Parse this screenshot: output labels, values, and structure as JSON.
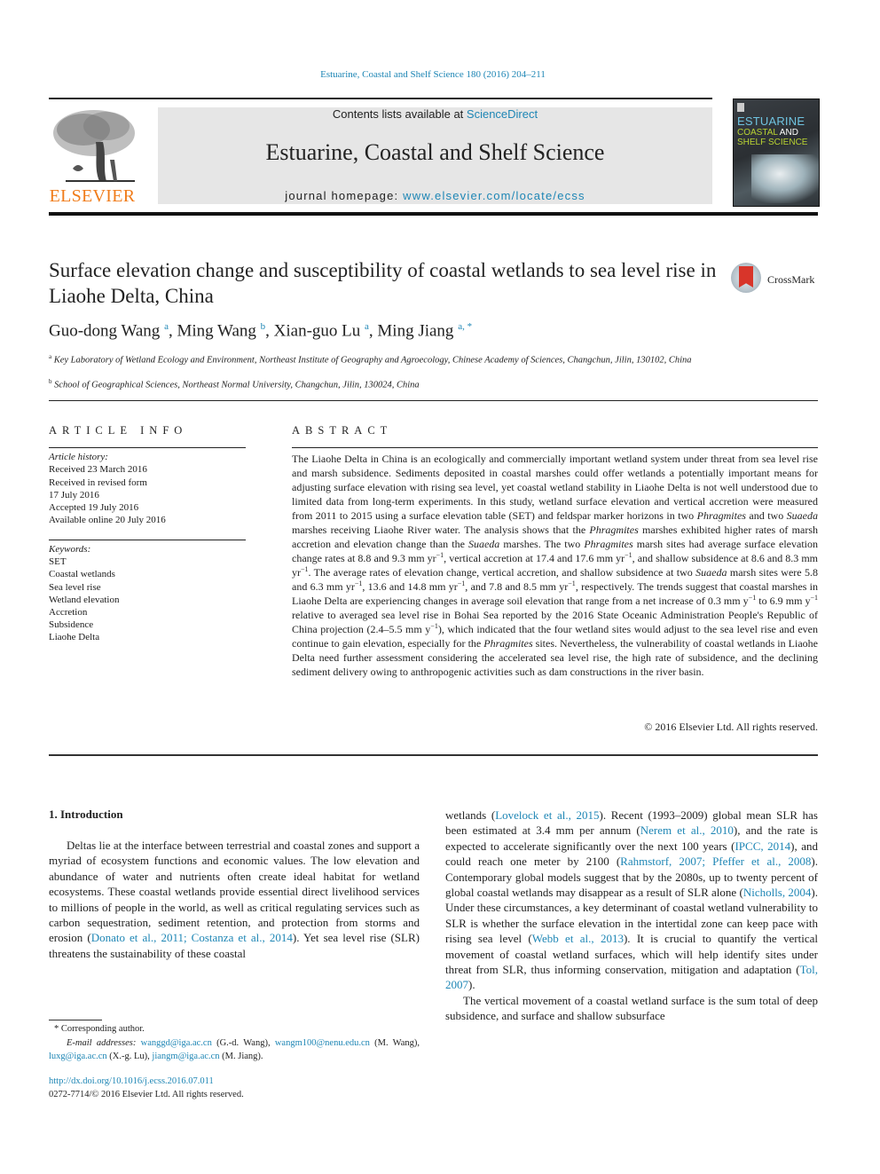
{
  "header": {
    "citation": "Estuarine, Coastal and Shelf Science 180 (2016) 204–211",
    "publisher_logo_text": "ELSEVIER",
    "contents_prefix": "Contents lists available at ",
    "contents_link": "ScienceDirect",
    "journal_title": "Estuarine, Coastal and Shelf Science",
    "homepage_prefix": "journal homepage: ",
    "homepage_link": "www.elsevier.com/locate/ecss",
    "cover": {
      "line1": "ESTUARINE",
      "line2a": "COASTAL",
      "line2b": " AND",
      "line3": "SHELF SCIENCE"
    }
  },
  "article": {
    "title": "Surface elevation change and susceptibility of coastal wetlands to sea level rise in Liaohe Delta, China",
    "crossmark_label": "CrossMark",
    "authors": [
      {
        "name": "Guo-dong Wang",
        "sup": "a"
      },
      {
        "name": "Ming Wang",
        "sup": "b"
      },
      {
        "name": "Xian-guo Lu",
        "sup": "a"
      },
      {
        "name": "Ming Jiang",
        "sup": "a, *"
      }
    ],
    "affiliations": [
      {
        "key": "a",
        "text": "Key Laboratory of Wetland Ecology and Environment, Northeast Institute of Geography and Agroecology, Chinese Academy of Sciences, Changchun, Jilin, 130102, China"
      },
      {
        "key": "b",
        "text": "School of Geographical Sciences, Northeast Normal University, Changchun, Jilin, 130024, China"
      }
    ]
  },
  "article_info": {
    "heading": "ARTICLE INFO",
    "history_caption": "Article history:",
    "history": [
      "Received 23 March 2016",
      "Received in revised form",
      "17 July 2016",
      "Accepted 19 July 2016",
      "Available online 20 July 2016"
    ],
    "keywords_caption": "Keywords:",
    "keywords": [
      "SET",
      "Coastal wetlands",
      "Sea level rise",
      "Wetland elevation",
      "Accretion",
      "Subsidence",
      "Liaohe Delta"
    ]
  },
  "abstract": {
    "heading": "ABSTRACT",
    "segments": [
      {
        "t": "The Liaohe Delta in China is an ecologically and commercially important wetland system under threat from sea level rise and marsh subsidence. Sediments deposited in coastal marshes could offer wetlands a potentially important means for adjusting surface elevation with rising sea level, yet coastal wetland stability in Liaohe Delta is not well understood due to limited data from long-term experiments. In this study, wetland surface elevation and vertical accretion were measured from 2011 to 2015 using a surface elevation table (SET) and feldspar marker horizons in two "
      },
      {
        "t": "Phragmites",
        "s": "i"
      },
      {
        "t": " and two "
      },
      {
        "t": "Suaeda",
        "s": "i"
      },
      {
        "t": " marshes receiving Liaohe River water. The analysis shows that the "
      },
      {
        "t": "Phragmites",
        "s": "i"
      },
      {
        "t": " marshes exhibited higher rates of marsh accretion and elevation change than the "
      },
      {
        "t": "Suaeda",
        "s": "i"
      },
      {
        "t": " marshes. The two "
      },
      {
        "t": "Phragmites",
        "s": "i"
      },
      {
        "t": " marsh sites had average surface elevation change rates at 8.8 and 9.3 mm yr"
      },
      {
        "t": "−1",
        "s": "sup"
      },
      {
        "t": ", vertical accretion at 17.4 and 17.6 mm yr"
      },
      {
        "t": "−1",
        "s": "sup"
      },
      {
        "t": ", and shallow subsidence at 8.6 and 8.3 mm yr"
      },
      {
        "t": "−1",
        "s": "sup"
      },
      {
        "t": ". The average rates of elevation change, vertical accretion, and shallow subsidence at two "
      },
      {
        "t": "Suaeda",
        "s": "i"
      },
      {
        "t": " marsh sites were 5.8 and 6.3 mm yr"
      },
      {
        "t": "−1",
        "s": "sup"
      },
      {
        "t": ", 13.6 and 14.8 mm yr"
      },
      {
        "t": "−1",
        "s": "sup"
      },
      {
        "t": ", and 7.8 and 8.5 mm yr"
      },
      {
        "t": "−1",
        "s": "sup"
      },
      {
        "t": ", respectively. The trends suggest that coastal marshes in Liaohe Delta are experiencing changes in average soil elevation that range from a net increase of 0.3 mm y"
      },
      {
        "t": "−1",
        "s": "sup"
      },
      {
        "t": " to 6.9 mm y"
      },
      {
        "t": "−1",
        "s": "sup"
      },
      {
        "t": " relative to averaged sea level rise in Bohai Sea reported by the 2016 State Oceanic Administration People's Republic of China projection (2.4–5.5 mm y"
      },
      {
        "t": "−1",
        "s": "sup"
      },
      {
        "t": "), which indicated that the four wetland sites would adjust to the sea level rise and even continue to gain elevation, especially for the "
      },
      {
        "t": "Phragmites",
        "s": "i"
      },
      {
        "t": " sites. Nevertheless, the vulnerability of coastal wetlands in Liaohe Delta need further assessment considering the accelerated sea level rise, the high rate of subsidence, and the declining sediment delivery owing to anthropogenic activities such as dam constructions in the river basin."
      }
    ],
    "copyright": "© 2016 Elsevier Ltd. All rights reserved."
  },
  "introduction": {
    "heading": "1.  Introduction",
    "col1": [
      {
        "t": "Deltas lie at the interface between terrestrial and coastal zones and support a myriad of ecosystem functions and economic values. The low elevation and abundance of water and nutrients often create ideal habitat for wetland ecosystems. These coastal wetlands provide essential direct livelihood services to millions of people in the world, as well as critical regulating services such as carbon sequestration, sediment retention, and protection from storms and erosion ("
      },
      {
        "t": "Donato et al., 2011; Costanza et al., 2014",
        "s": "link"
      },
      {
        "t": "). Yet sea level rise (SLR) threatens the sustainability of these coastal"
      }
    ],
    "col2_p1": [
      {
        "t": "wetlands ("
      },
      {
        "t": "Lovelock et al., 2015",
        "s": "link"
      },
      {
        "t": "). Recent (1993–2009) global mean SLR has been estimated at 3.4 mm per annum ("
      },
      {
        "t": "Nerem et al., 2010",
        "s": "link"
      },
      {
        "t": "), and the rate is expected to accelerate significantly over the next 100 years ("
      },
      {
        "t": "IPCC, 2014",
        "s": "link"
      },
      {
        "t": "), and could reach one meter by 2100 ("
      },
      {
        "t": "Rahmstorf, 2007; Pfeffer et al., 2008",
        "s": "link"
      },
      {
        "t": "). Contemporary global models suggest that by the 2080s, up to twenty percent of global coastal wetlands may disappear as a result of SLR alone ("
      },
      {
        "t": "Nicholls, 2004",
        "s": "link"
      },
      {
        "t": "). Under these circumstances, a key determinant of coastal wetland vulnerability to SLR is whether the surface elevation in the intertidal zone can keep pace with rising sea level ("
      },
      {
        "t": "Webb et al., 2013",
        "s": "link"
      },
      {
        "t": "). It is crucial to quantify the vertical movement of coastal wetland surfaces, which will help identify sites under threat from SLR, thus informing conservation, mitigation and adaptation ("
      },
      {
        "t": "Tol, 2007",
        "s": "link"
      },
      {
        "t": ")."
      }
    ],
    "col2_p2": [
      {
        "t": "The vertical movement of a coastal wetland surface is the sum total of deep subsidence, and surface and shallow subsurface"
      }
    ]
  },
  "footnotes": {
    "corresponding": "* Corresponding author.",
    "email_caption": "E-mail addresses:",
    "emails": [
      {
        "addr": "wanggd@iga.ac.cn",
        "who": "(G.-d. Wang)"
      },
      {
        "addr": "wangm100@nenu.edu.cn",
        "who": "(M. Wang)"
      },
      {
        "addr": "luxg@iga.ac.cn",
        "who": "(X.-g. Lu)"
      },
      {
        "addr": "jiangm@iga.ac.cn",
        "who": "(M. Jiang)."
      }
    ],
    "doi": "http://dx.doi.org/10.1016/j.ecss.2016.07.011",
    "issn_line": "0272-7714/© 2016 Elsevier Ltd. All rights reserved."
  },
  "colors": {
    "link": "#1e86b5",
    "elsevier_orange": "#f07c1a",
    "banner_bg": "#e6e6e6"
  }
}
